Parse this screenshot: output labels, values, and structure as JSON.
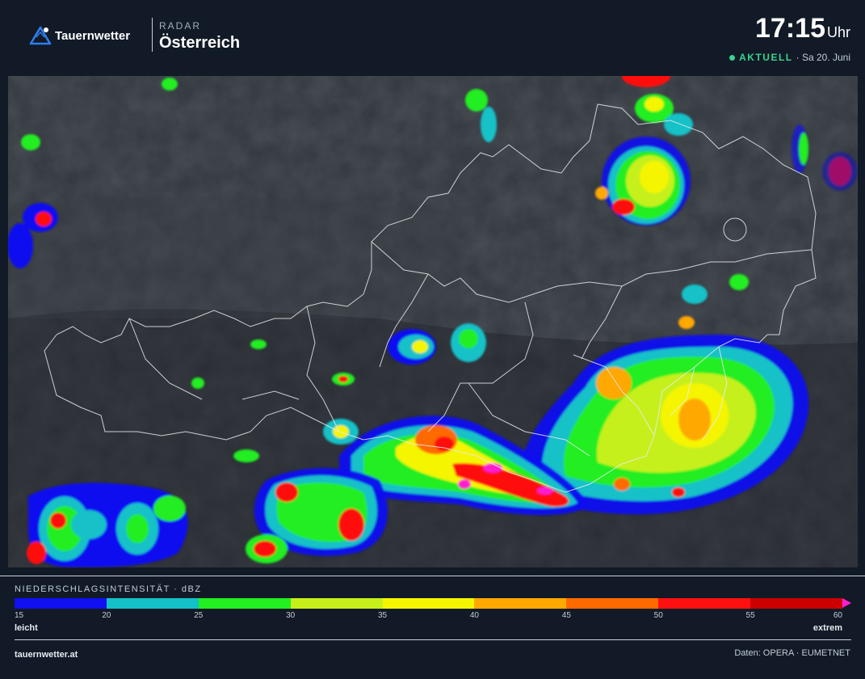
{
  "header": {
    "brand": "Tauernwetter",
    "section_label": "RADAR",
    "region": "Österreich",
    "time": "17:15",
    "time_unit": "Uhr",
    "status": "AKTUELL",
    "date": "· Sa 20. Juni"
  },
  "legend": {
    "title": "NIEDERSCHLAGSINTENSITÄT · dBZ",
    "ticks": [
      "15",
      "20",
      "25",
      "30",
      "35",
      "40",
      "45",
      "50",
      "55",
      "60"
    ],
    "low_label": "leicht",
    "high_label": "extrem",
    "colors": [
      "#1010f0",
      "#14c1c8",
      "#22ee22",
      "#c6f01a",
      "#f5f500",
      "#ffa800",
      "#ff6a00",
      "#ff1010",
      "#cc0000"
    ],
    "overflow_color": "#ff1fd0"
  },
  "footer": {
    "site": "tauernwetter.at",
    "credits": "Daten: OPERA · EUMETNET"
  },
  "map": {
    "background_color": "#2d3239",
    "border_color": "#e8ecf0"
  }
}
